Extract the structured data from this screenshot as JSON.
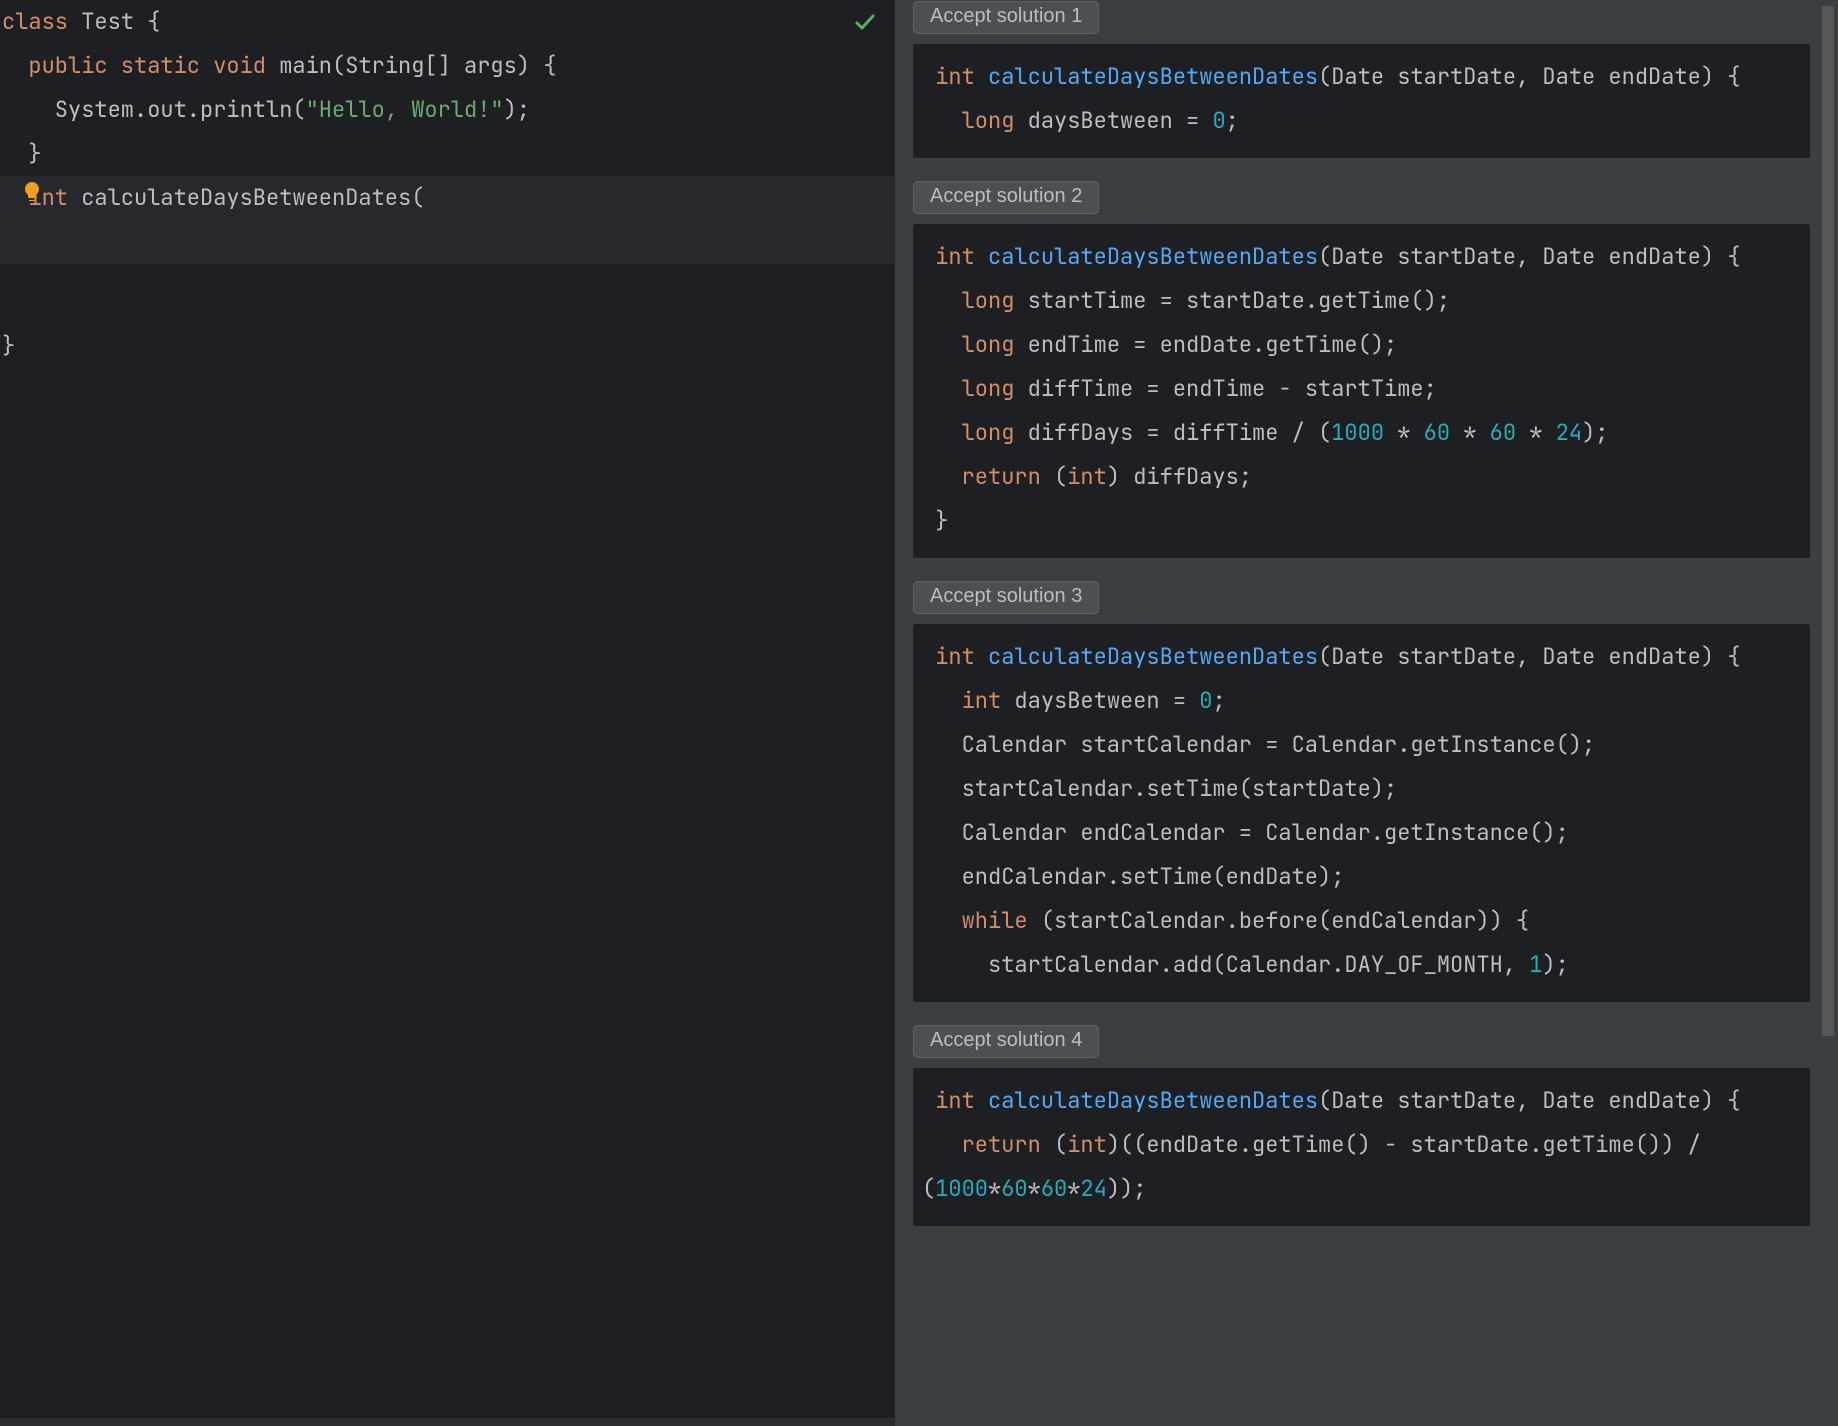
{
  "editor": {
    "l1a": "class ",
    "l1b": "Test {",
    "l2a": "  public static void ",
    "l2b": "main(String[] args) {",
    "l3a": "    System.out.println(",
    "l3b": "\"Hello, World!\"",
    "l3c": ");",
    "l4": "  }",
    "l5a": "  int ",
    "l5b": "calculateDaysBetweenDates(",
    "l6": "",
    "l7": "}"
  },
  "solutions": [
    {
      "button": "Accept solution 1",
      "code": [
        {
          "cls": "tok-kw",
          "t": " int "
        },
        {
          "cls": "tok-func",
          "t": "calculateDaysBetweenDates"
        },
        {
          "cls": "",
          "t": "(Date startDate, Date endDate) {\n"
        },
        {
          "cls": "tok-kw",
          "t": "   long "
        },
        {
          "cls": "",
          "t": "daysBetween = "
        },
        {
          "cls": "tok-num",
          "t": "0"
        },
        {
          "cls": "",
          "t": ";\n"
        }
      ]
    },
    {
      "button": "Accept solution 2",
      "code": [
        {
          "cls": "tok-kw",
          "t": " int "
        },
        {
          "cls": "tok-func",
          "t": "calculateDaysBetweenDates"
        },
        {
          "cls": "",
          "t": "(Date startDate, Date endDate) {\n"
        },
        {
          "cls": "tok-kw",
          "t": "   long "
        },
        {
          "cls": "",
          "t": "startTime = startDate.getTime();\n"
        },
        {
          "cls": "tok-kw",
          "t": "   long "
        },
        {
          "cls": "",
          "t": "endTime = endDate.getTime();\n"
        },
        {
          "cls": "tok-kw",
          "t": "   long "
        },
        {
          "cls": "",
          "t": "diffTime = endTime - startTime;\n"
        },
        {
          "cls": "tok-kw",
          "t": "   long "
        },
        {
          "cls": "",
          "t": "diffDays = diffTime / ("
        },
        {
          "cls": "tok-num",
          "t": "1000"
        },
        {
          "cls": "",
          "t": " * "
        },
        {
          "cls": "tok-num",
          "t": "60"
        },
        {
          "cls": "",
          "t": " * "
        },
        {
          "cls": "tok-num",
          "t": "60"
        },
        {
          "cls": "",
          "t": " * "
        },
        {
          "cls": "tok-num",
          "t": "24"
        },
        {
          "cls": "",
          "t": ");\n"
        },
        {
          "cls": "tok-kw",
          "t": "   return "
        },
        {
          "cls": "",
          "t": "("
        },
        {
          "cls": "tok-kw",
          "t": "int"
        },
        {
          "cls": "",
          "t": ") diffDays;\n"
        },
        {
          "cls": "",
          "t": " }\n"
        }
      ]
    },
    {
      "button": "Accept solution 3",
      "code": [
        {
          "cls": "tok-kw",
          "t": " int "
        },
        {
          "cls": "tok-func",
          "t": "calculateDaysBetweenDates"
        },
        {
          "cls": "",
          "t": "(Date startDate, Date endDate) {\n"
        },
        {
          "cls": "tok-kw",
          "t": "   int "
        },
        {
          "cls": "",
          "t": "daysBetween = "
        },
        {
          "cls": "tok-num",
          "t": "0"
        },
        {
          "cls": "",
          "t": ";\n"
        },
        {
          "cls": "",
          "t": "   Calendar startCalendar = Calendar.getInstance();\n"
        },
        {
          "cls": "",
          "t": "   startCalendar.setTime(startDate);\n"
        },
        {
          "cls": "",
          "t": "   Calendar endCalendar = Calendar.getInstance();\n"
        },
        {
          "cls": "",
          "t": "   endCalendar.setTime(endDate);\n"
        },
        {
          "cls": "tok-kw",
          "t": "   while "
        },
        {
          "cls": "",
          "t": "(startCalendar.before(endCalendar)) {\n"
        },
        {
          "cls": "",
          "t": "     startCalendar.add(Calendar.DAY_OF_MONTH, "
        },
        {
          "cls": "tok-num",
          "t": "1"
        },
        {
          "cls": "",
          "t": ");"
        }
      ]
    },
    {
      "button": "Accept solution 4",
      "code": [
        {
          "cls": "tok-kw",
          "t": " int "
        },
        {
          "cls": "tok-func",
          "t": "calculateDaysBetweenDates"
        },
        {
          "cls": "",
          "t": "(Date startDate, Date endDate) {\n"
        },
        {
          "cls": "tok-kw",
          "t": "   return "
        },
        {
          "cls": "",
          "t": "("
        },
        {
          "cls": "tok-kw",
          "t": "int"
        },
        {
          "cls": "",
          "t": ")((endDate.getTime() - startDate.getTime()) / ("
        },
        {
          "cls": "tok-num",
          "t": "1000"
        },
        {
          "cls": "",
          "t": "*"
        },
        {
          "cls": "tok-num",
          "t": "60"
        },
        {
          "cls": "",
          "t": "*"
        },
        {
          "cls": "tok-num",
          "t": "60"
        },
        {
          "cls": "",
          "t": "*"
        },
        {
          "cls": "tok-num",
          "t": "24"
        },
        {
          "cls": "",
          "t": "));"
        }
      ]
    }
  ]
}
